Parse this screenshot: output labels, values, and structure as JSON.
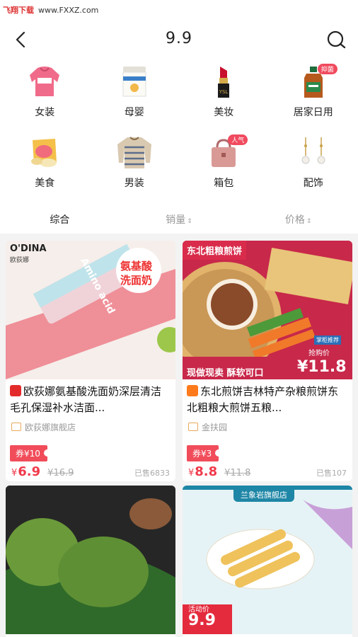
{
  "watermark": {
    "brand": "飞翔下载",
    "url": "www.FXXZ.com"
  },
  "header": {
    "title": "9.9"
  },
  "categories": [
    {
      "label": "女装",
      "icon": "hoodie-icon"
    },
    {
      "label": "母婴",
      "icon": "formula-can-icon"
    },
    {
      "label": "美妆",
      "icon": "lipstick-icon"
    },
    {
      "label": "居家日用",
      "icon": "disinfectant-bottle-icon",
      "tag": "抑菌"
    },
    {
      "label": "美食",
      "icon": "snack-bag-icon"
    },
    {
      "label": "男装",
      "icon": "sweater-icon"
    },
    {
      "label": "箱包",
      "icon": "handbag-icon",
      "tag": "人气"
    },
    {
      "label": "配饰",
      "icon": "earrings-icon"
    }
  ],
  "sort": {
    "comprehensive": "综合",
    "sales": "销量",
    "price": "价格"
  },
  "products": [
    {
      "title": "欧荻娜氨基酸洗面奶深层清洁毛孔保湿补水洁面...",
      "platform": "天猫",
      "store": "欧荻娜旗舰店",
      "coupon": "券¥10",
      "currency": "¥",
      "price": "6.9",
      "original_price": "¥16.9",
      "sold": "已售6833",
      "image_text": {
        "brand": "O'DINA",
        "brand_cn": "欧荻娜",
        "badge_line1": "氨基酸",
        "badge_line2": "洗面奶",
        "tube": "Amino acid"
      }
    },
    {
      "title": "东北煎饼吉林特产杂粮煎饼东北粗粮大煎饼五粮...",
      "platform": "淘",
      "store": "金扶园",
      "coupon": "券¥3",
      "currency": "¥",
      "price": "8.8",
      "original_price": "¥11.8",
      "sold": "已售107",
      "image_text": {
        "header": "东北粗粮煎饼",
        "deal": "抢购价",
        "deal_price": "¥11.8",
        "slogan": "现做现卖  酥软可口",
        "tag": "掌柜推荐"
      }
    },
    {
      "title": "",
      "image_text": {}
    },
    {
      "title": "",
      "image_text": {
        "store_banner": "兰象岩旗舰店",
        "deal": "活动价",
        "deal_price": "9.9"
      }
    }
  ],
  "colors": {
    "accent": "#f03a4b",
    "coupon": "#f14c5a",
    "feed_bg": "#f3f3f3"
  }
}
